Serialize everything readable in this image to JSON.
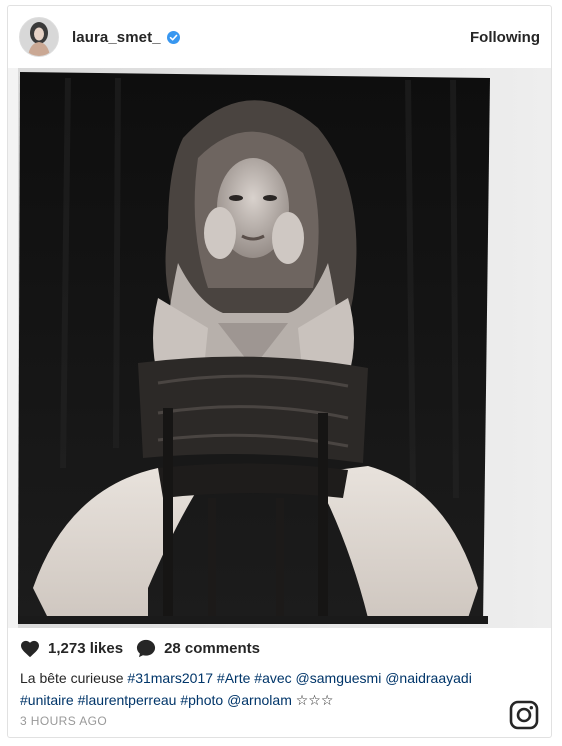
{
  "post": {
    "username": "laura_smet_",
    "follow_label": "Following",
    "likes": "1,273 likes",
    "comments": "28 comments",
    "caption_parts": [
      {
        "text": "La bête curieuse ",
        "type": "text"
      },
      {
        "text": "#31mars2017",
        "type": "tag"
      },
      {
        "text": " ",
        "type": "text"
      },
      {
        "text": "#Arte",
        "type": "tag"
      },
      {
        "text": " ",
        "type": "text"
      },
      {
        "text": "#avec",
        "type": "tag"
      },
      {
        "text": " ",
        "type": "text"
      },
      {
        "text": "@samguesmi",
        "type": "tag"
      },
      {
        "text": " ",
        "type": "text"
      },
      {
        "text": "@naidraayadi",
        "type": "tag"
      },
      {
        "text": " ",
        "type": "text"
      },
      {
        "text": "#unitaire",
        "type": "tag"
      },
      {
        "text": " ",
        "type": "text"
      },
      {
        "text": "#laurentperreau",
        "type": "tag"
      },
      {
        "text": " ",
        "type": "text"
      },
      {
        "text": "#photo",
        "type": "tag"
      },
      {
        "text": " ",
        "type": "text"
      },
      {
        "text": "@arnolam",
        "type": "tag"
      },
      {
        "text": " ☆☆☆",
        "type": "text"
      }
    ],
    "timestamp": "3 HOURS AGO"
  },
  "icons": {
    "verified": "verified-badge-icon",
    "like": "heart-icon",
    "comment": "comment-bubble-icon",
    "brand": "instagram-logo-icon"
  },
  "colors": {
    "text": "#262626",
    "verified": "#3897f0",
    "meta": "#999999",
    "tag": "#003569"
  }
}
